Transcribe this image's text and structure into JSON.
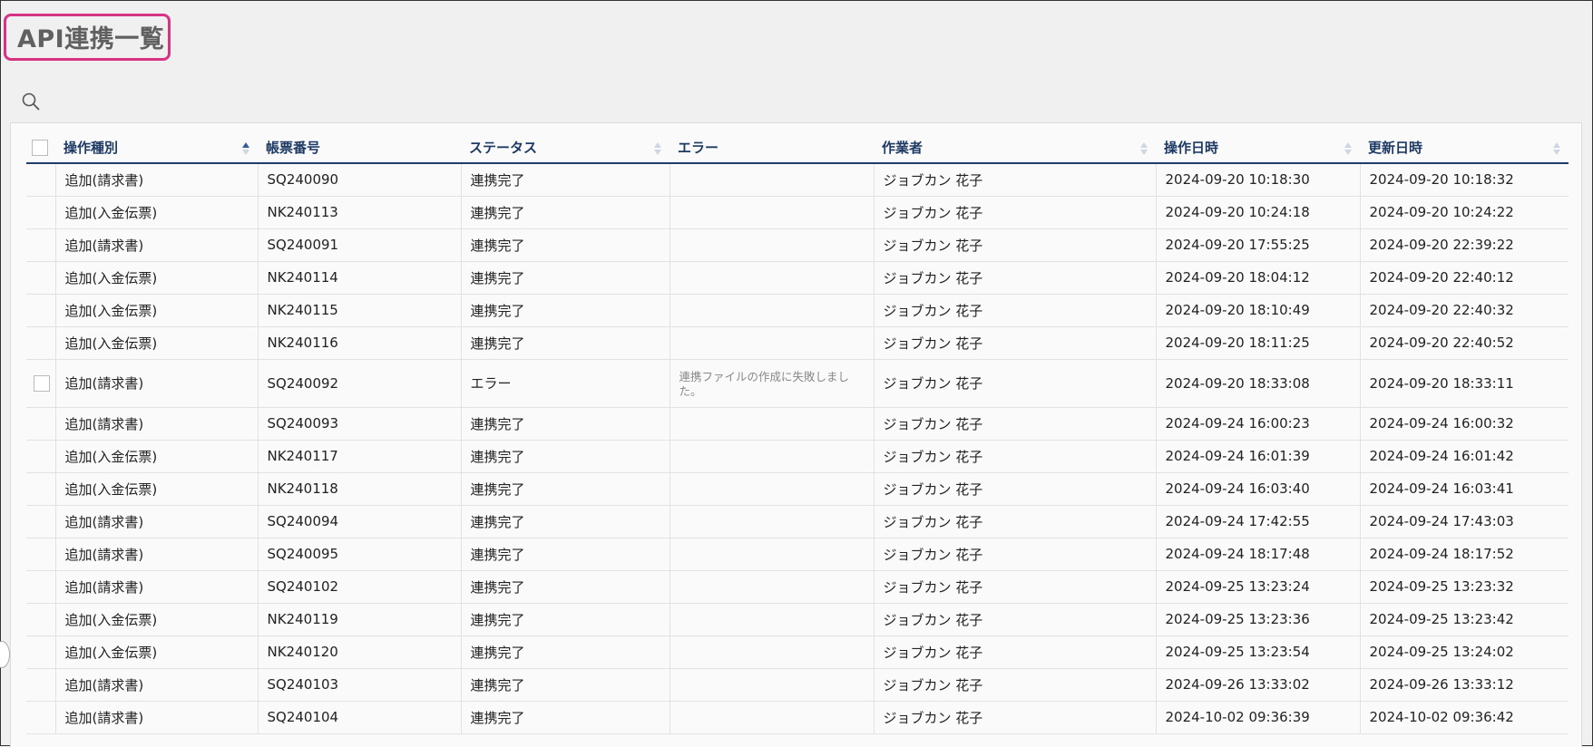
{
  "page": {
    "title": "API連携一覧"
  },
  "icons": {
    "search": "search-icon",
    "sort_asc": "sort-ascending-icon",
    "sort_both": "sort-icon"
  },
  "colors": {
    "title_highlight": "#d63384",
    "header_text": "#1e3a64",
    "header_rule": "#1f3b6a",
    "sort_active": "#3a5c95"
  },
  "table": {
    "columns": [
      {
        "key": "op_type",
        "label": "操作種別",
        "sort": "asc"
      },
      {
        "key": "doc_no",
        "label": "帳票番号",
        "sort": "none"
      },
      {
        "key": "status",
        "label": "ステータス",
        "sort": "both"
      },
      {
        "key": "error",
        "label": "エラー",
        "sort": "none"
      },
      {
        "key": "operator",
        "label": "作業者",
        "sort": "both"
      },
      {
        "key": "op_datetime",
        "label": "操作日時",
        "sort": "both"
      },
      {
        "key": "updated_datetime",
        "label": "更新日時",
        "sort": "both"
      }
    ],
    "rows": [
      {
        "checkbox": false,
        "op_type": "追加(請求書)",
        "doc_no": "SQ240090",
        "status": "連携完了",
        "error": "",
        "operator": "ジョブカン 花子",
        "op_datetime": "2024-09-20 10:18:30",
        "updated_datetime": "2024-09-20 10:18:32"
      },
      {
        "checkbox": false,
        "op_type": "追加(入金伝票)",
        "doc_no": "NK240113",
        "status": "連携完了",
        "error": "",
        "operator": "ジョブカン 花子",
        "op_datetime": "2024-09-20 10:24:18",
        "updated_datetime": "2024-09-20 10:24:22"
      },
      {
        "checkbox": false,
        "op_type": "追加(請求書)",
        "doc_no": "SQ240091",
        "status": "連携完了",
        "error": "",
        "operator": "ジョブカン 花子",
        "op_datetime": "2024-09-20 17:55:25",
        "updated_datetime": "2024-09-20 22:39:22"
      },
      {
        "checkbox": false,
        "op_type": "追加(入金伝票)",
        "doc_no": "NK240114",
        "status": "連携完了",
        "error": "",
        "operator": "ジョブカン 花子",
        "op_datetime": "2024-09-20 18:04:12",
        "updated_datetime": "2024-09-20 22:40:12"
      },
      {
        "checkbox": false,
        "op_type": "追加(入金伝票)",
        "doc_no": "NK240115",
        "status": "連携完了",
        "error": "",
        "operator": "ジョブカン 花子",
        "op_datetime": "2024-09-20 18:10:49",
        "updated_datetime": "2024-09-20 22:40:32"
      },
      {
        "checkbox": false,
        "op_type": "追加(入金伝票)",
        "doc_no": "NK240116",
        "status": "連携完了",
        "error": "",
        "operator": "ジョブカン 花子",
        "op_datetime": "2024-09-20 18:11:25",
        "updated_datetime": "2024-09-20 22:40:52"
      },
      {
        "checkbox": true,
        "op_type": "追加(請求書)",
        "doc_no": "SQ240092",
        "status": "エラー",
        "error": "連携ファイルの作成に失敗しました。",
        "operator": "ジョブカン 花子",
        "op_datetime": "2024-09-20 18:33:08",
        "updated_datetime": "2024-09-20 18:33:11"
      },
      {
        "checkbox": false,
        "op_type": "追加(請求書)",
        "doc_no": "SQ240093",
        "status": "連携完了",
        "error": "",
        "operator": "ジョブカン 花子",
        "op_datetime": "2024-09-24 16:00:23",
        "updated_datetime": "2024-09-24 16:00:32"
      },
      {
        "checkbox": false,
        "op_type": "追加(入金伝票)",
        "doc_no": "NK240117",
        "status": "連携完了",
        "error": "",
        "operator": "ジョブカン 花子",
        "op_datetime": "2024-09-24 16:01:39",
        "updated_datetime": "2024-09-24 16:01:42"
      },
      {
        "checkbox": false,
        "op_type": "追加(入金伝票)",
        "doc_no": "NK240118",
        "status": "連携完了",
        "error": "",
        "operator": "ジョブカン 花子",
        "op_datetime": "2024-09-24 16:03:40",
        "updated_datetime": "2024-09-24 16:03:41"
      },
      {
        "checkbox": false,
        "op_type": "追加(請求書)",
        "doc_no": "SQ240094",
        "status": "連携完了",
        "error": "",
        "operator": "ジョブカン 花子",
        "op_datetime": "2024-09-24 17:42:55",
        "updated_datetime": "2024-09-24 17:43:03"
      },
      {
        "checkbox": false,
        "op_type": "追加(請求書)",
        "doc_no": "SQ240095",
        "status": "連携完了",
        "error": "",
        "operator": "ジョブカン 花子",
        "op_datetime": "2024-09-24 18:17:48",
        "updated_datetime": "2024-09-24 18:17:52"
      },
      {
        "checkbox": false,
        "op_type": "追加(請求書)",
        "doc_no": "SQ240102",
        "status": "連携完了",
        "error": "",
        "operator": "ジョブカン 花子",
        "op_datetime": "2024-09-25 13:23:24",
        "updated_datetime": "2024-09-25 13:23:32"
      },
      {
        "checkbox": false,
        "op_type": "追加(入金伝票)",
        "doc_no": "NK240119",
        "status": "連携完了",
        "error": "",
        "operator": "ジョブカン 花子",
        "op_datetime": "2024-09-25 13:23:36",
        "updated_datetime": "2024-09-25 13:23:42"
      },
      {
        "checkbox": false,
        "op_type": "追加(入金伝票)",
        "doc_no": "NK240120",
        "status": "連携完了",
        "error": "",
        "operator": "ジョブカン 花子",
        "op_datetime": "2024-09-25 13:23:54",
        "updated_datetime": "2024-09-25 13:24:02"
      },
      {
        "checkbox": false,
        "op_type": "追加(請求書)",
        "doc_no": "SQ240103",
        "status": "連携完了",
        "error": "",
        "operator": "ジョブカン 花子",
        "op_datetime": "2024-09-26 13:33:02",
        "updated_datetime": "2024-09-26 13:33:12"
      },
      {
        "checkbox": false,
        "op_type": "追加(請求書)",
        "doc_no": "SQ240104",
        "status": "連携完了",
        "error": "",
        "operator": "ジョブカン 花子",
        "op_datetime": "2024-10-02 09:36:39",
        "updated_datetime": "2024-10-02 09:36:42"
      }
    ]
  }
}
